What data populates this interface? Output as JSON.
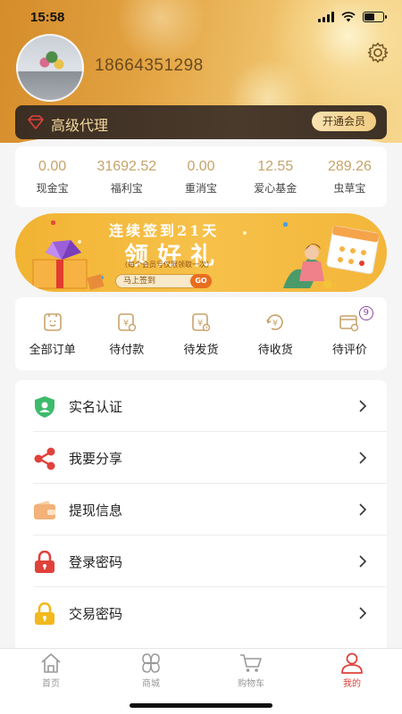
{
  "status_bar": {
    "time": "15:58"
  },
  "profile": {
    "phone": "18664351298"
  },
  "agent": {
    "level": "高级代理",
    "action": "开通会员"
  },
  "balances": [
    {
      "value": "0.00",
      "label": "现金宝"
    },
    {
      "value": "31692.52",
      "label": "福利宝"
    },
    {
      "value": "0.00",
      "label": "重消宝"
    },
    {
      "value": "12.55",
      "label": "爱心基金"
    },
    {
      "value": "289.26",
      "label": "虫草宝"
    }
  ],
  "banner": {
    "title": "连续签到21天",
    "headline": "领好礼",
    "subtitle": "（每个会员号仅限领取一次）",
    "button": "马上签到",
    "go": "GO"
  },
  "orders": [
    {
      "label": "全部订单",
      "icon": "all-orders-icon"
    },
    {
      "label": "待付款",
      "icon": "pending-payment-icon"
    },
    {
      "label": "待发货",
      "icon": "pending-shipment-icon"
    },
    {
      "label": "待收货",
      "icon": "pending-receipt-icon"
    },
    {
      "label": "待评价",
      "icon": "pending-review-icon",
      "badge": "9"
    }
  ],
  "menu": [
    {
      "label": "实名认证",
      "icon": "verified-shield-icon",
      "color": "#3dbb6b"
    },
    {
      "label": "我要分享",
      "icon": "share-icon",
      "color": "#e0413a"
    },
    {
      "label": "提现信息",
      "icon": "wallet-icon",
      "color": "#f2b27a"
    },
    {
      "label": "登录密码",
      "icon": "lock-icon",
      "color": "#e0413a"
    },
    {
      "label": "交易密码",
      "icon": "lock-icon",
      "color": "#f3b81e"
    }
  ],
  "tabbar": [
    {
      "label": "首页",
      "icon": "home-icon"
    },
    {
      "label": "商城",
      "icon": "mall-icon"
    },
    {
      "label": "购物车",
      "icon": "cart-icon"
    },
    {
      "label": "我的",
      "icon": "profile-icon",
      "active": true
    }
  ],
  "colors": {
    "accent": "#e0413a",
    "gold": "#c7a36a",
    "header": "#e2a241"
  }
}
